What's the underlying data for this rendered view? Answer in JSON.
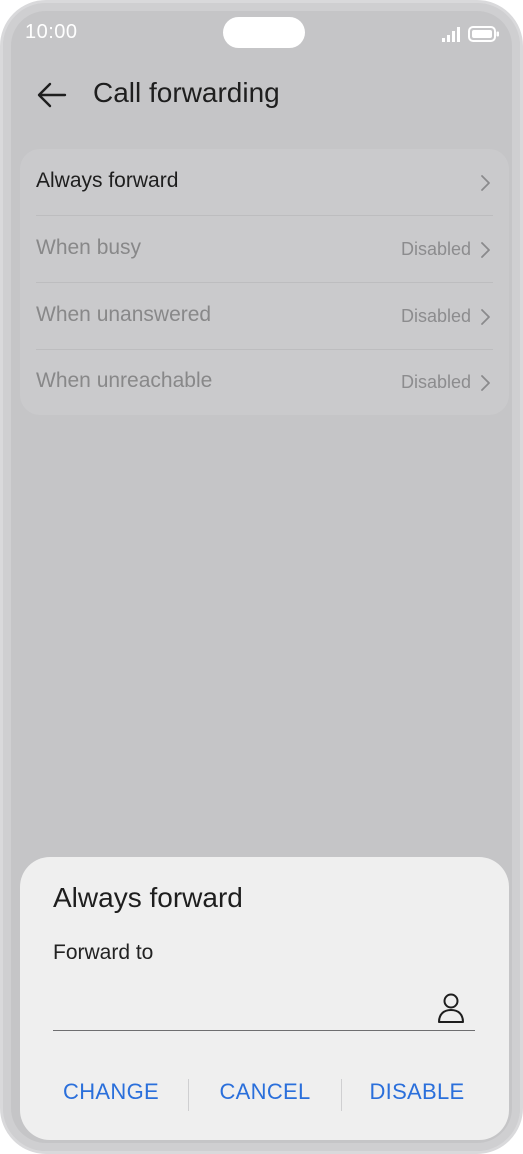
{
  "status": {
    "time": "10:00",
    "icons": [
      "signal-icon",
      "battery-icon"
    ]
  },
  "header": {
    "back_icon": "arrow-left-icon",
    "title": "Call forwarding"
  },
  "settings": {
    "items": [
      {
        "label": "Always forward",
        "value": "",
        "enabled": true
      },
      {
        "label": "When busy",
        "value": "Disabled",
        "enabled": false
      },
      {
        "label": "When unanswered",
        "value": "Disabled",
        "enabled": false
      },
      {
        "label": "When unreachable",
        "value": "Disabled",
        "enabled": false
      }
    ]
  },
  "dialog": {
    "title": "Always forward",
    "field_label": "Forward to",
    "field_value": "",
    "contact_icon": "person-icon",
    "buttons": {
      "change": "CHANGE",
      "cancel": "CANCEL",
      "disable": "DISABLE"
    }
  },
  "colors": {
    "accent": "#2a6fdb",
    "scrim": "#c5c5c7",
    "sheet": "#efefef"
  }
}
